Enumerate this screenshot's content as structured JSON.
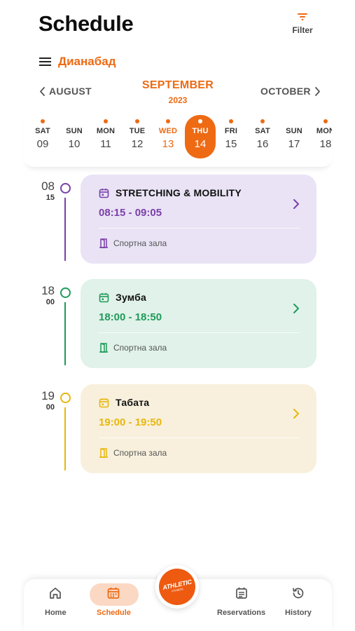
{
  "header": {
    "title": "Schedule",
    "filter_label": "Filter",
    "location": "Дианабад"
  },
  "months": {
    "prev": "AUGUST",
    "current": "SEPTEMBER",
    "year": "2023",
    "next": "OCTOBER"
  },
  "days": [
    {
      "name": "SAT",
      "num": "09",
      "has_event": true,
      "state": "normal"
    },
    {
      "name": "SUN",
      "num": "10",
      "has_event": false,
      "state": "normal"
    },
    {
      "name": "MON",
      "num": "11",
      "has_event": true,
      "state": "normal"
    },
    {
      "name": "TUE",
      "num": "12",
      "has_event": true,
      "state": "normal"
    },
    {
      "name": "WED",
      "num": "13",
      "has_event": true,
      "state": "today"
    },
    {
      "name": "THU",
      "num": "14",
      "has_event": true,
      "state": "selected"
    },
    {
      "name": "FRI",
      "num": "15",
      "has_event": true,
      "state": "normal"
    },
    {
      "name": "SAT",
      "num": "16",
      "has_event": true,
      "state": "normal"
    },
    {
      "name": "SUN",
      "num": "17",
      "has_event": false,
      "state": "normal"
    },
    {
      "name": "MON",
      "num": "18",
      "has_event": true,
      "state": "normal"
    }
  ],
  "classes": [
    {
      "hour": "08",
      "minute": "15",
      "name": "STRETCHING & MOBILITY",
      "time": "08:15 - 09:05",
      "room": "Спортна зала",
      "color": "#7b3fa8",
      "bg": "#e9e3f5"
    },
    {
      "hour": "18",
      "minute": "00",
      "name": "Зумба",
      "time": "18:00 - 18:50",
      "room": "Спортна зала",
      "color": "#1f9a5a",
      "bg": "#e0f2e9"
    },
    {
      "hour": "19",
      "minute": "00",
      "name": "Табата",
      "time": "19:00 - 19:50",
      "room": "Спортна зала",
      "color": "#e8b70c",
      "bg": "#f8f0dd"
    }
  ],
  "nav": {
    "home": "Home",
    "schedule": "Schedule",
    "reservations": "Reservations",
    "history": "History",
    "brand": "ATHLETIC",
    "brand_sub": "FITNESS"
  },
  "colors": {
    "accent": "#ee6a13",
    "accent_light": "#fbd8c3"
  },
  "icons": {
    "filter": "filter-icon",
    "menu": "hamburger-menu-icon",
    "prev": "chevron-left-icon",
    "next": "chevron-right-icon",
    "calendar": "calendar-icon",
    "door": "door-icon",
    "home": "home-icon",
    "reservations": "reservations-icon",
    "history": "history-icon"
  }
}
